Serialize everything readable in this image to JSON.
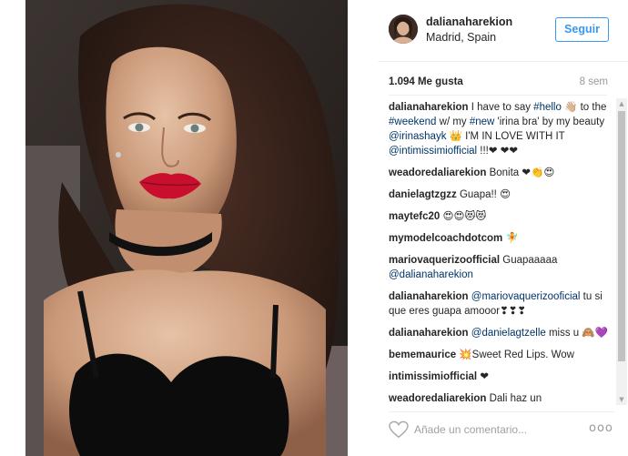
{
  "post": {
    "username": "dalianaharekion",
    "location": "Madrid, Spain",
    "follow_label": "Seguir",
    "likes": "1.094 Me gusta",
    "time": "8 sem",
    "comment_placeholder": "Añade un comentario...",
    "more_label": "ooo"
  },
  "comments": [
    {
      "user": "dalianaharekion",
      "parts": [
        {
          "t": " I have to say "
        },
        {
          "t": "#hello",
          "tag": true
        },
        {
          "t": " 👋🏼 to the "
        },
        {
          "t": "#weekend",
          "tag": true
        },
        {
          "t": " w/ my "
        },
        {
          "t": "#new",
          "tag": true
        },
        {
          "t": " 'irina bra' by my beauty "
        },
        {
          "t": "@irinashayk",
          "tag": true
        },
        {
          "t": " 👑 I'M IN LOVE WITH IT "
        },
        {
          "t": "@intimissimiofficial",
          "tag": true
        },
        {
          "t": " !!!❤ ❤❤"
        }
      ]
    },
    {
      "user": "weadoredaliarekion",
      "parts": [
        {
          "t": " Bonita ❤👏😍"
        }
      ]
    },
    {
      "user": "danielagtzgzz",
      "parts": [
        {
          "t": " Guapa!! 😍"
        }
      ]
    },
    {
      "user": "maytefc20",
      "parts": [
        {
          "t": " 😍😍😻😻"
        }
      ]
    },
    {
      "user": "mymodelcoachdotcom",
      "parts": [
        {
          "t": " 🧚"
        }
      ]
    },
    {
      "user": "mariovaquerizoofficial",
      "parts": [
        {
          "t": " Guapaaaaa "
        },
        {
          "t": "@dalianaharekion",
          "tag": true
        }
      ]
    },
    {
      "user": "dalianaharekion",
      "parts": [
        {
          "t": " "
        },
        {
          "t": "@mariovaquerizooficial",
          "tag": true
        },
        {
          "t": " tu si que eres guapa amooor❣❣❣"
        }
      ]
    },
    {
      "user": "dalianaharekion",
      "parts": [
        {
          "t": " "
        },
        {
          "t": "@danielagtzelle",
          "tag": true
        },
        {
          "t": " miss u 🙈💜"
        }
      ]
    },
    {
      "user": "bememaurice",
      "parts": [
        {
          "t": " 💥Sweet Red Lips. Wow"
        }
      ]
    },
    {
      "user": "intimissimiofficial",
      "parts": [
        {
          "t": " ❤"
        }
      ]
    },
    {
      "user": "weadoredaliarekion",
      "parts": [
        {
          "t": " Dali haz un"
        }
      ]
    }
  ],
  "scrollbar": {
    "up_arrow": "▲",
    "down_arrow": "▼"
  },
  "icons": {
    "heart": "heart-outline-icon",
    "more": "more-options-icon",
    "scroll_up": "scroll-up-arrow-icon",
    "scroll_down": "scroll-down-arrow-icon"
  },
  "colors": {
    "link": "#003569",
    "follow": "#3897f0",
    "lips": "#c8102e"
  }
}
